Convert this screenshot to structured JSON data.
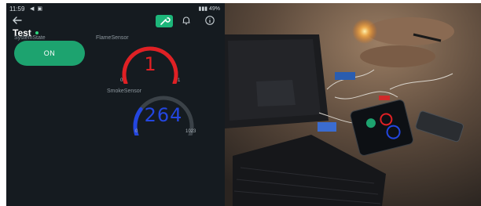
{
  "status_bar": {
    "time": "11:59",
    "left_icons": "◀ ▣",
    "battery": "49%"
  },
  "app_bar": {
    "back_icon": "arrow-left-icon",
    "tool_icon": "wrench-icon",
    "bell_icon": "bell-icon",
    "info_icon": "info-icon"
  },
  "dashboard": {
    "title": "Test",
    "system_state": {
      "label": "SystemState",
      "button_label": "ON",
      "color": "#1da36f"
    },
    "flame_sensor": {
      "label": "FlameSensor",
      "value": "1",
      "min": "0",
      "max": "1",
      "fill_fraction": 1,
      "color": "#e02024"
    },
    "smoke_sensor": {
      "label": "SmokeSensor",
      "value": "264",
      "min": "0",
      "max": "1023",
      "fill_fraction": 0.258,
      "color": "#2346e0"
    }
  },
  "photo": {
    "subject": "hardware-setup-photo"
  }
}
